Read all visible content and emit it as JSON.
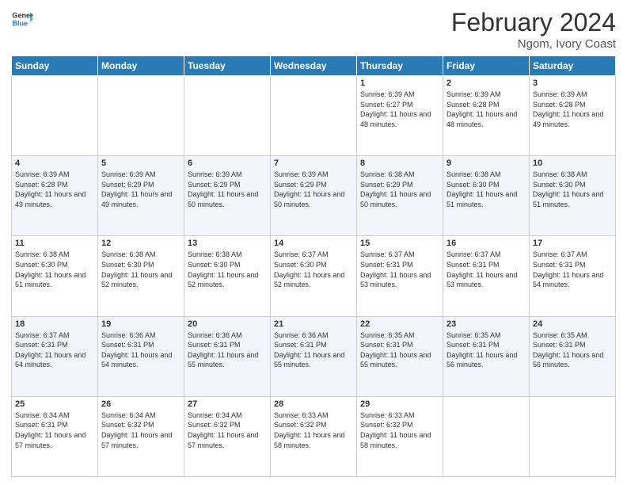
{
  "logo": {
    "line1": "General",
    "line2": "Blue"
  },
  "title": "February 2024",
  "subtitle": "Ngom, Ivory Coast",
  "days_of_week": [
    "Sunday",
    "Monday",
    "Tuesday",
    "Wednesday",
    "Thursday",
    "Friday",
    "Saturday"
  ],
  "weeks": [
    [
      {
        "day": "",
        "info": ""
      },
      {
        "day": "",
        "info": ""
      },
      {
        "day": "",
        "info": ""
      },
      {
        "day": "",
        "info": ""
      },
      {
        "day": "1",
        "info": "Sunrise: 6:39 AM\nSunset: 6:27 PM\nDaylight: 11 hours and 48 minutes."
      },
      {
        "day": "2",
        "info": "Sunrise: 6:39 AM\nSunset: 6:28 PM\nDaylight: 11 hours and 48 minutes."
      },
      {
        "day": "3",
        "info": "Sunrise: 6:39 AM\nSunset: 6:28 PM\nDaylight: 11 hours and 49 minutes."
      }
    ],
    [
      {
        "day": "4",
        "info": "Sunrise: 6:39 AM\nSunset: 6:28 PM\nDaylight: 11 hours and 49 minutes."
      },
      {
        "day": "5",
        "info": "Sunrise: 6:39 AM\nSunset: 6:29 PM\nDaylight: 11 hours and 49 minutes."
      },
      {
        "day": "6",
        "info": "Sunrise: 6:39 AM\nSunset: 6:29 PM\nDaylight: 11 hours and 50 minutes."
      },
      {
        "day": "7",
        "info": "Sunrise: 6:39 AM\nSunset: 6:29 PM\nDaylight: 11 hours and 50 minutes."
      },
      {
        "day": "8",
        "info": "Sunrise: 6:38 AM\nSunset: 6:29 PM\nDaylight: 11 hours and 50 minutes."
      },
      {
        "day": "9",
        "info": "Sunrise: 6:38 AM\nSunset: 6:30 PM\nDaylight: 11 hours and 51 minutes."
      },
      {
        "day": "10",
        "info": "Sunrise: 6:38 AM\nSunset: 6:30 PM\nDaylight: 11 hours and 51 minutes."
      }
    ],
    [
      {
        "day": "11",
        "info": "Sunrise: 6:38 AM\nSunset: 6:30 PM\nDaylight: 11 hours and 51 minutes."
      },
      {
        "day": "12",
        "info": "Sunrise: 6:38 AM\nSunset: 6:30 PM\nDaylight: 11 hours and 52 minutes."
      },
      {
        "day": "13",
        "info": "Sunrise: 6:38 AM\nSunset: 6:30 PM\nDaylight: 11 hours and 52 minutes."
      },
      {
        "day": "14",
        "info": "Sunrise: 6:37 AM\nSunset: 6:30 PM\nDaylight: 11 hours and 52 minutes."
      },
      {
        "day": "15",
        "info": "Sunrise: 6:37 AM\nSunset: 6:31 PM\nDaylight: 11 hours and 53 minutes."
      },
      {
        "day": "16",
        "info": "Sunrise: 6:37 AM\nSunset: 6:31 PM\nDaylight: 11 hours and 53 minutes."
      },
      {
        "day": "17",
        "info": "Sunrise: 6:37 AM\nSunset: 6:31 PM\nDaylight: 11 hours and 54 minutes."
      }
    ],
    [
      {
        "day": "18",
        "info": "Sunrise: 6:37 AM\nSunset: 6:31 PM\nDaylight: 11 hours and 54 minutes."
      },
      {
        "day": "19",
        "info": "Sunrise: 6:36 AM\nSunset: 6:31 PM\nDaylight: 11 hours and 54 minutes."
      },
      {
        "day": "20",
        "info": "Sunrise: 6:36 AM\nSunset: 6:31 PM\nDaylight: 11 hours and 55 minutes."
      },
      {
        "day": "21",
        "info": "Sunrise: 6:36 AM\nSunset: 6:31 PM\nDaylight: 11 hours and 55 minutes."
      },
      {
        "day": "22",
        "info": "Sunrise: 6:35 AM\nSunset: 6:31 PM\nDaylight: 11 hours and 55 minutes."
      },
      {
        "day": "23",
        "info": "Sunrise: 6:35 AM\nSunset: 6:31 PM\nDaylight: 11 hours and 56 minutes."
      },
      {
        "day": "24",
        "info": "Sunrise: 6:35 AM\nSunset: 6:31 PM\nDaylight: 11 hours and 56 minutes."
      }
    ],
    [
      {
        "day": "25",
        "info": "Sunrise: 6:34 AM\nSunset: 6:31 PM\nDaylight: 11 hours and 57 minutes."
      },
      {
        "day": "26",
        "info": "Sunrise: 6:34 AM\nSunset: 6:32 PM\nDaylight: 11 hours and 57 minutes."
      },
      {
        "day": "27",
        "info": "Sunrise: 6:34 AM\nSunset: 6:32 PM\nDaylight: 11 hours and 57 minutes."
      },
      {
        "day": "28",
        "info": "Sunrise: 6:33 AM\nSunset: 6:32 PM\nDaylight: 11 hours and 58 minutes."
      },
      {
        "day": "29",
        "info": "Sunrise: 6:33 AM\nSunset: 6:32 PM\nDaylight: 11 hours and 58 minutes."
      },
      {
        "day": "",
        "info": ""
      },
      {
        "day": "",
        "info": ""
      }
    ]
  ]
}
